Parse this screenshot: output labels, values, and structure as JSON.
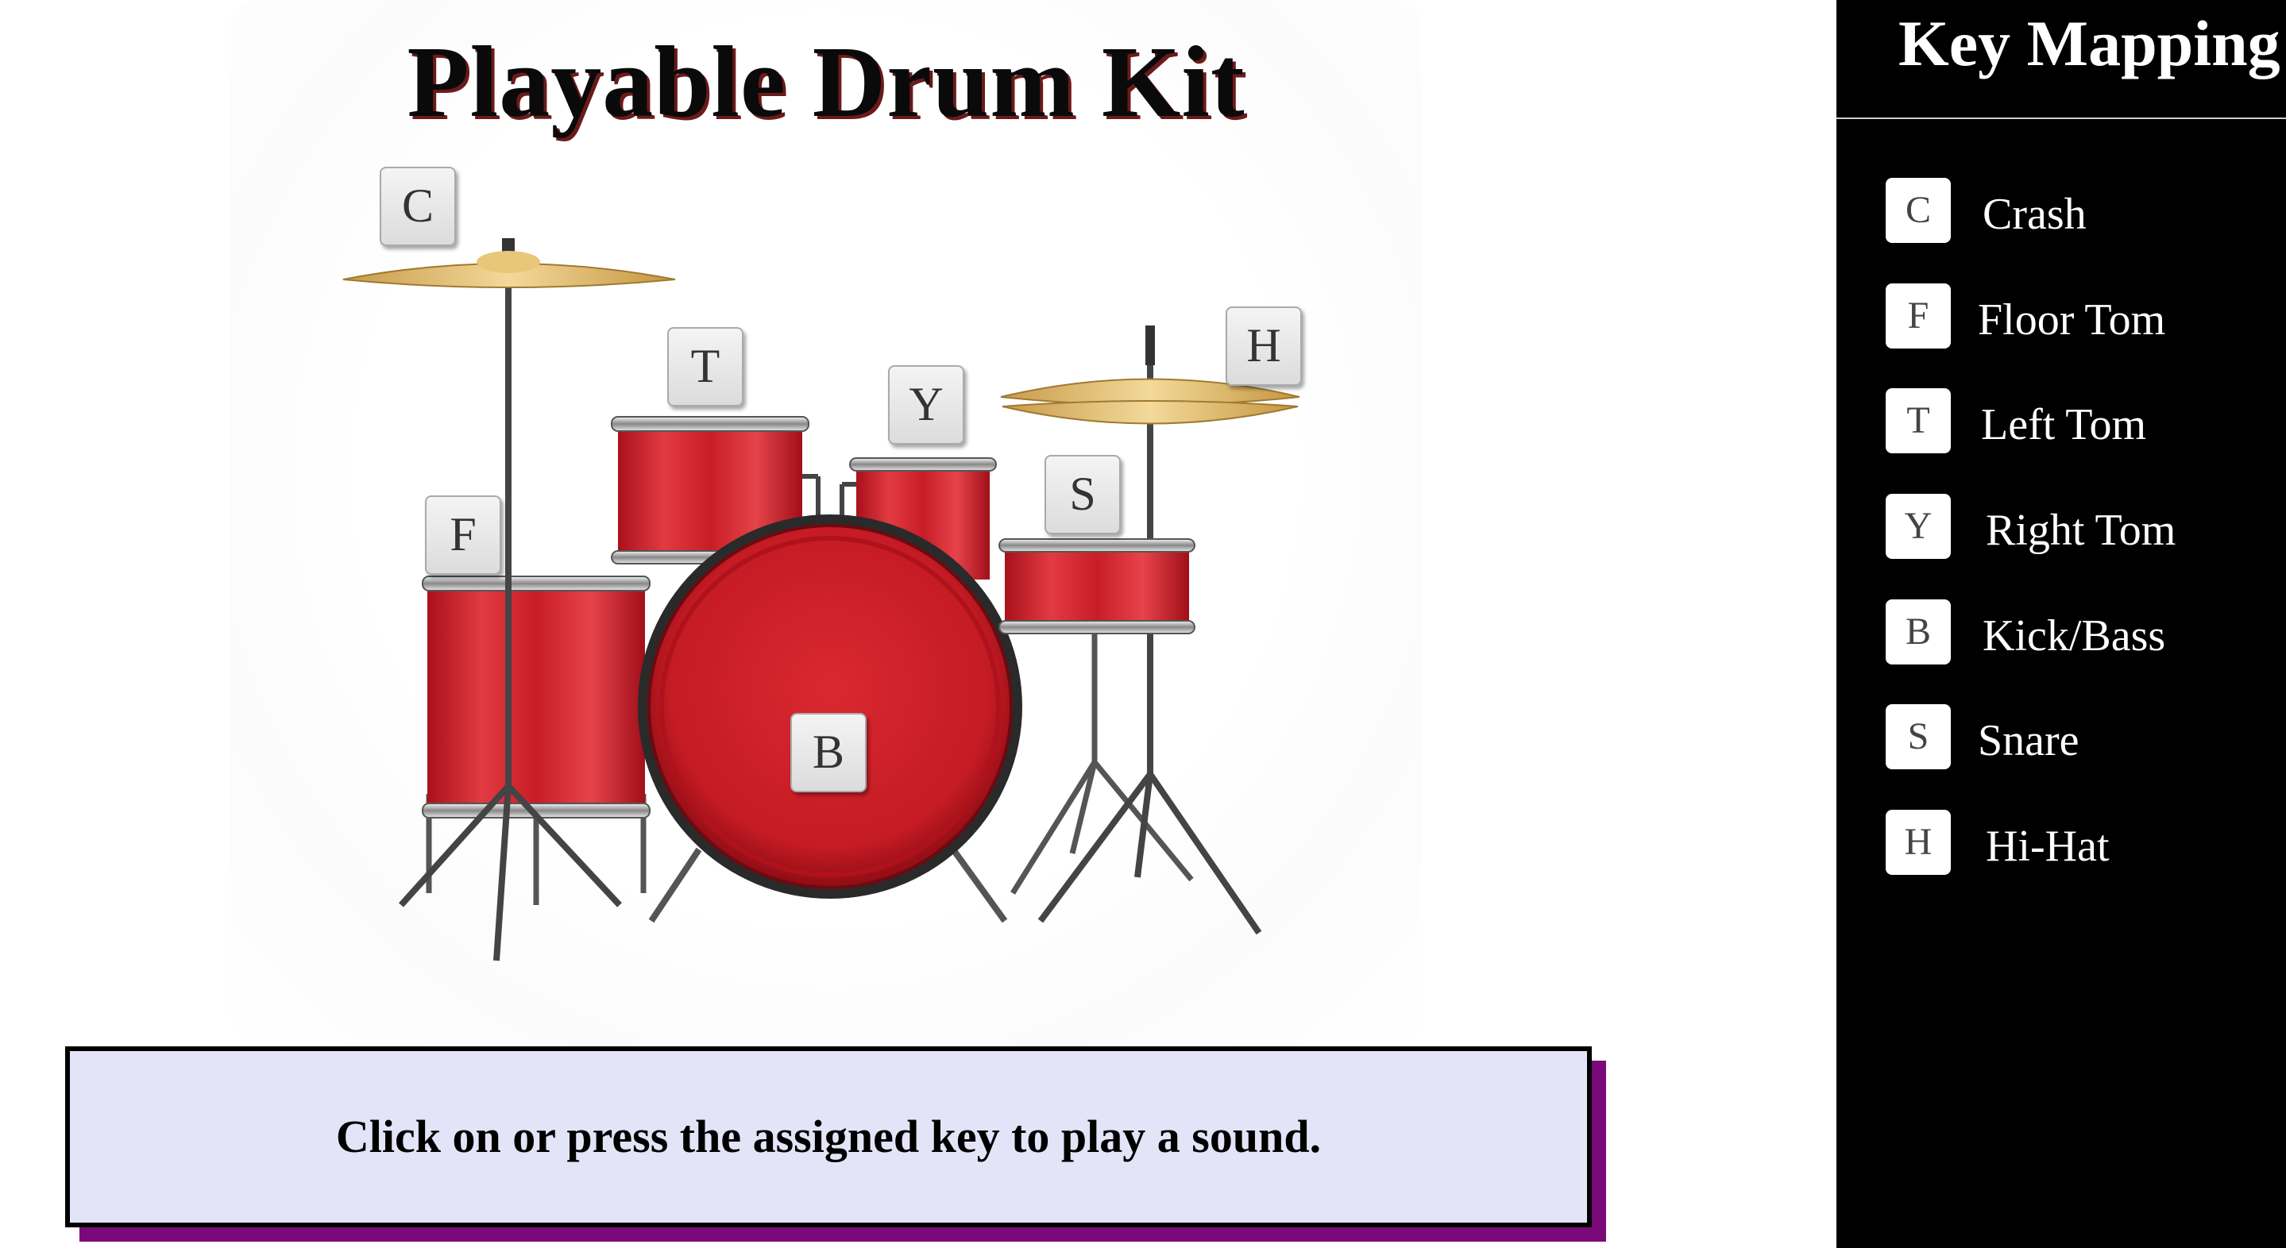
{
  "title": "Playable Drum Kit",
  "message": "Click on or press the assigned key to play a sound.",
  "drum_keys": {
    "crash": "C",
    "hihat": "H",
    "left_tom": "T",
    "right_tom": "Y",
    "snare": "S",
    "floor_tom": "F",
    "kick": "B"
  },
  "sidebar": {
    "title": "Key Mapping",
    "items": [
      {
        "key": "C",
        "label": "Crash"
      },
      {
        "key": "F",
        "label": "Floor Tom"
      },
      {
        "key": "T",
        "label": "Left Tom"
      },
      {
        "key": "Y",
        "label": "Right Tom"
      },
      {
        "key": "B",
        "label": "Kick/Bass"
      },
      {
        "key": "S",
        "label": "Snare"
      },
      {
        "key": "H",
        "label": "Hi-Hat"
      }
    ]
  },
  "colors": {
    "drum_red": "#d41f2a",
    "cymbal_gold": "#d8b060",
    "message_bg": "#e4e4f8",
    "message_shadow": "#7a0a7a",
    "sidebar_bg": "#000000"
  }
}
